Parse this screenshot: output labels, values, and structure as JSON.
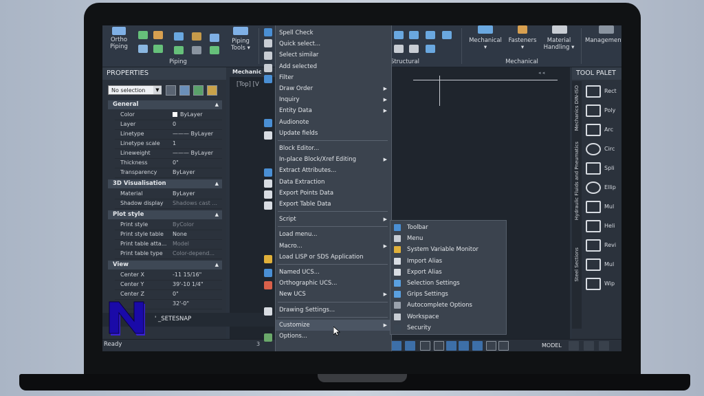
{
  "ribbon": {
    "ortho_piping": "Ortho\nPiping",
    "piping_tools": "Piping\nTools ▾",
    "piping_group": "Piping",
    "structural_group": "Structural",
    "mechanical": "Mechanical\n▾",
    "fasteners": "Fasteners\n▾",
    "material_handling": "Material\nHandling ▾",
    "mechanical_group": "Mechanical",
    "management": "Management"
  },
  "properties": {
    "title": "PROPERTIES",
    "selection": "No selection",
    "sections": [
      {
        "name": "General",
        "rows": [
          {
            "name": "Color",
            "value": "ByLayer"
          },
          {
            "name": "Layer",
            "value": "0"
          },
          {
            "name": "Linetype",
            "value": "——— ByLayer"
          },
          {
            "name": "Linetype scale",
            "value": "1"
          },
          {
            "name": "Lineweight",
            "value": "——— ByLayer"
          },
          {
            "name": "Thickness",
            "value": "0\""
          },
          {
            "name": "Transparency",
            "value": "ByLayer"
          }
        ]
      },
      {
        "name": "3D Visualisation",
        "rows": [
          {
            "name": "Material",
            "value": "ByLayer"
          },
          {
            "name": "Shadow display",
            "value": "Shadows cast ..."
          }
        ]
      },
      {
        "name": "Plot style",
        "rows": [
          {
            "name": "Print style",
            "value": "ByColor"
          },
          {
            "name": "Print style table",
            "value": "None"
          },
          {
            "name": "Print table atta...",
            "value": "Model"
          },
          {
            "name": "Print table type",
            "value": "Color-depend..."
          }
        ]
      },
      {
        "name": "View",
        "rows": [
          {
            "name": "Center X",
            "value": "-11 15/16\""
          },
          {
            "name": "Center Y",
            "value": "39'-10 1/4\""
          },
          {
            "name": "Center Z",
            "value": "0\""
          },
          {
            "name": "",
            "value": "32'-0\""
          }
        ]
      }
    ]
  },
  "canvas": {
    "tab": "Mechanic",
    "view_label": "[Top] [V"
  },
  "command": {
    "text": "' _SETESNAP",
    "status": "Ready"
  },
  "context_menu": {
    "items": [
      {
        "label": "Spell Check"
      },
      {
        "label": "Quick select..."
      },
      {
        "label": "Select similar"
      },
      {
        "label": "Add selected"
      },
      {
        "label": "Filter"
      },
      {
        "label": "Draw Order",
        "sub": true
      },
      {
        "label": "Inquiry",
        "sub": true
      },
      {
        "label": "Entity Data",
        "sub": true
      },
      {
        "label": "Audionote"
      },
      {
        "label": "Update fields"
      },
      {
        "label": "Block Editor...",
        "sep": true
      },
      {
        "label": "In-place Block/Xref Editing",
        "sub": true
      },
      {
        "label": "Extract Attributes..."
      },
      {
        "label": "Data Extraction"
      },
      {
        "label": "Export Points Data"
      },
      {
        "label": "Export Table Data"
      },
      {
        "label": "Script",
        "sub": true,
        "sep": true
      },
      {
        "label": "Load menu...",
        "sep": true
      },
      {
        "label": "Macro...",
        "sub": true
      },
      {
        "label": "Load LISP or SDS Application"
      },
      {
        "label": "Named UCS...",
        "sep": true
      },
      {
        "label": "Orthographic UCS..."
      },
      {
        "label": "New UCS",
        "sub": true
      },
      {
        "label": "Drawing Settings...",
        "sep": true
      },
      {
        "label": "Customize",
        "sub": true,
        "sep": true
      },
      {
        "label": "Options..."
      }
    ]
  },
  "submenu": {
    "items": [
      {
        "label": "Toolbar",
        "icon": "toolbar-icon",
        "color": "#4a8fd4"
      },
      {
        "label": "Menu",
        "icon": "menu-icon",
        "color": "#c8cdd4"
      },
      {
        "label": "System Variable Monitor",
        "icon": "gear-icon",
        "color": "#e0b03a"
      },
      {
        "label": "Import Alias",
        "icon": "import-icon",
        "color": "#d9dde3"
      },
      {
        "label": "Export Alias",
        "icon": "export-icon",
        "color": "#d9dde3"
      },
      {
        "label": "Selection Settings",
        "icon": "selection-icon",
        "color": "#5aa0e0"
      },
      {
        "label": "Grips Settings",
        "icon": "grips-icon",
        "color": "#5aa0e0"
      },
      {
        "label": "Autocomplete Options",
        "icon": "autocomplete-icon",
        "color": "#9aa2ad"
      },
      {
        "label": "Workspace",
        "icon": "workspace-gear-icon",
        "color": "#c8cdd4"
      },
      {
        "label": "Security",
        "icon": "security-icon",
        "color": "#3a4450"
      }
    ]
  },
  "tool_palette": {
    "title": "TOOL PALET",
    "items": [
      "Rect",
      "Poly",
      "Arc",
      "Circ",
      "Spli",
      "Ellip",
      "Mul",
      "Heli",
      "Revi",
      "Mul",
      "Wip"
    ],
    "tabs": [
      "Mechanics DIN-ISO",
      "Hydraulic Fluids and Pneumatics",
      "Steel Sections"
    ]
  },
  "status": {
    "model_label": "MODEL"
  }
}
